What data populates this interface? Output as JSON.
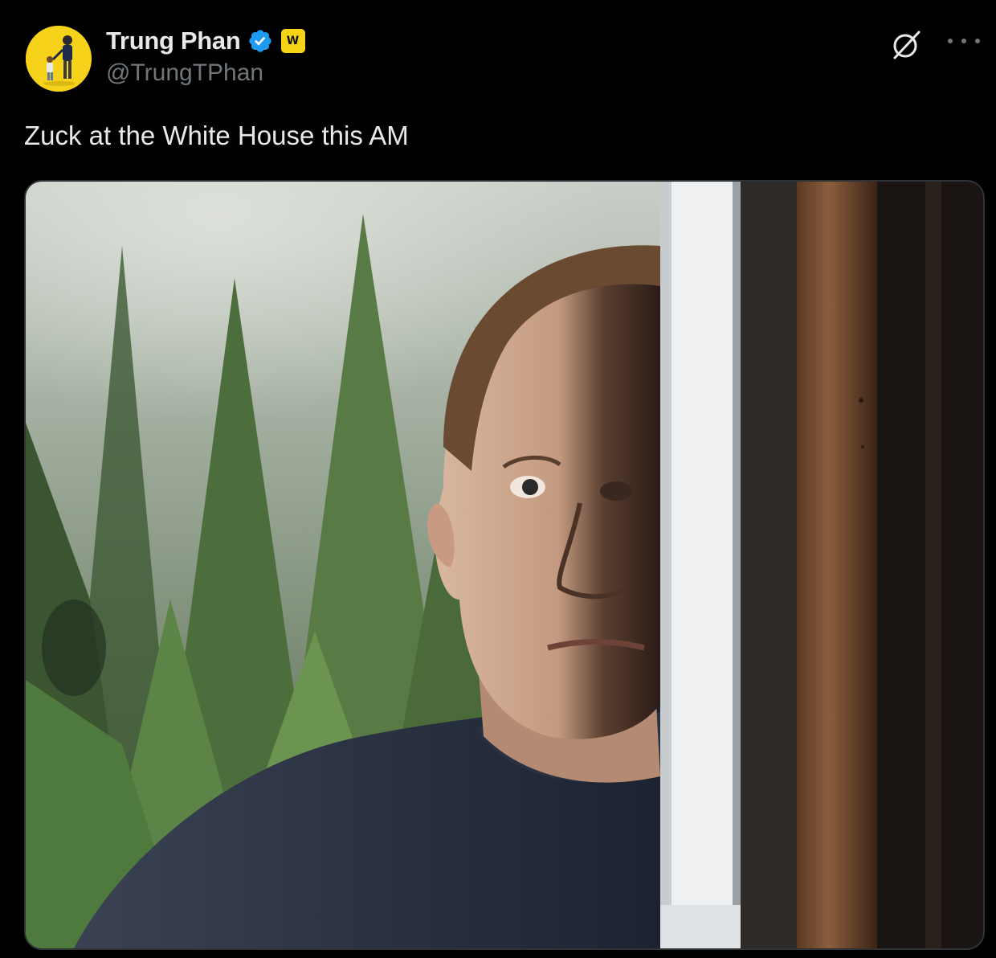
{
  "author": {
    "display_name": "Trung Phan",
    "handle": "@TrungTPhan",
    "verified": true,
    "verified_badge_color": "#1d9bf0",
    "affiliate_badge_letter": "W",
    "affiliate_badge_color": "#f5d317",
    "avatar_background": "#f7d21a"
  },
  "icons": {
    "grok": "grok-icon",
    "more": "more-options-icon",
    "verified": "verified-badge-icon"
  },
  "tweet": {
    "text": "Zuck at the White House this AM"
  },
  "theme": {
    "background": "#000000",
    "text_primary": "#e7e9ea",
    "text_secondary": "#71767b",
    "border": "#2f3336"
  }
}
